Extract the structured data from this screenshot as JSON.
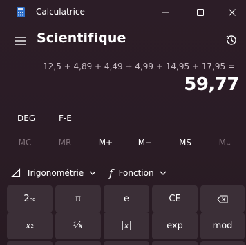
{
  "window": {
    "title": "Calculatrice",
    "controls": [
      "minimize-icon",
      "maximize-icon",
      "close-icon"
    ]
  },
  "header": {
    "menu_icon": "hamburger-icon",
    "mode": "Scientifique",
    "history_icon": "history-icon"
  },
  "display": {
    "expression": "12,5 + 4,89 + 4,49 + 4,99 + 14,95 + 17,95 =",
    "result": "59,77"
  },
  "angle_mode": {
    "deg": "DEG",
    "fe": "F-E"
  },
  "memory": {
    "mc": "MC",
    "mr": "MR",
    "mplus": "M+",
    "mminus": "M−",
    "ms": "MS",
    "mlist": "M",
    "mlist_chevron": "⌄"
  },
  "functions": {
    "trig_label": "Trigonométrie",
    "func_symbol": "f",
    "func_label": "Fonction"
  },
  "keys": {
    "row1": {
      "second_base": "2",
      "second_sup": "nd",
      "pi": "π",
      "e": "e",
      "ce": "CE",
      "backspace_icon": "backspace-icon"
    },
    "row2": {
      "square_base": "x",
      "square_sup": "2",
      "reciprocal": "¹⁄x",
      "abs": "|x|",
      "exp": "exp",
      "mod": "mod"
    }
  }
}
